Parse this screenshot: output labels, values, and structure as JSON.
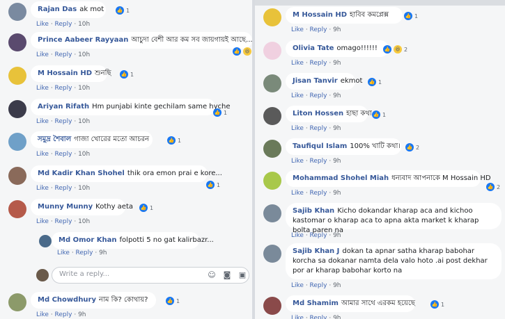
{
  "reply_placeholder": "Write a reply...",
  "comments_left": [
    {
      "name": "Rajan Das",
      "text": "ak mot",
      "actions": "Like · Reply · 10h",
      "reactions": "1",
      "avatar_color": "#7a8aa0"
    },
    {
      "name": "Prince Aabeer Rayyaan",
      "text": "আচুদা বেশী আর কম সব জায়গায়ই আছে...",
      "actions": "Like · Reply · 10h",
      "reactions": "3",
      "avatar_color": "#5a4a6e"
    },
    {
      "name": "M Hossain HD",
      "text": "শুনছি",
      "actions": "Like · Reply · 10h",
      "reactions": "1",
      "avatar_color": "#e8c23a"
    },
    {
      "name": "Ariyan Rifath",
      "text": "Hm punjabi kinte gechilam same hyche",
      "actions": "Like · Reply · 10h",
      "reactions": "1",
      "avatar_color": "#3b3b4a"
    },
    {
      "name": "সমুদ্র শৈবাল",
      "text": "গাজা খোরের মতো আচরন",
      "actions": "Like · Reply · 10h",
      "reactions": "1",
      "avatar_color": "#6fa0c8"
    },
    {
      "name": "Md Kadir Khan Shohel",
      "text": "thik ora emon prai e kore...",
      "actions": "Like · Reply · 10h",
      "reactions": "1",
      "avatar_color": "#8a6a5a"
    },
    {
      "name": "Munny Munny",
      "text": "Kothy aeta",
      "actions": "Like · Reply · 10h",
      "reactions": "1",
      "avatar_color": "#b55a4a"
    },
    {
      "name": "Md Chowdhury",
      "text": "নাম কি? কোথায়?",
      "actions": "Like · Reply · 9h",
      "reactions": "1",
      "avatar_color": "#8c9a6a"
    }
  ],
  "nested_reply": {
    "name": "Md Omor Khan",
    "text": "folpotti 5 no gat kalirbazr...",
    "actions": "Like · Reply · 9h",
    "avatar_color": "#4a6a8a"
  },
  "comments_right": [
    {
      "name": "M Hossain HD",
      "text": "হাবিব কমপ্লেক্স",
      "actions": "Like · Reply · 9h",
      "reactions": "1",
      "avatar_color": "#e8c23a"
    },
    {
      "name": "Olivia Tate",
      "text": "omago!!!!!!",
      "actions": "Like · Reply · 9h",
      "reactions": "2",
      "avatar_color": "#f0d0e0"
    },
    {
      "name": "Jisan Tanvir",
      "text": "ekmot",
      "actions": "Like · Reply · 9h",
      "reactions": "1",
      "avatar_color": "#7a8a7a"
    },
    {
      "name": "Liton Hossen",
      "text": "হাছা কথা",
      "actions": "Like · Reply · 9h",
      "reactions": "1",
      "avatar_color": "#5a5a5a"
    },
    {
      "name": "Taufiqul Islam",
      "text": "100% খাটি কথা।",
      "actions": "Like · Reply · 9h",
      "reactions": "2",
      "avatar_color": "#6a7a5a"
    },
    {
      "name": "Mohammad Shohel Miah",
      "text": "ধন্যবাদ আপনাকে M Hossain HD",
      "actions": "Like · Reply · 9h",
      "reactions": "2",
      "avatar_color": "#a8c84a"
    },
    {
      "name": "Sajib Khan",
      "text": "Kicho dokandar kharap aca and kichoo kastomar o kharap aca to apna akta market k kharap bolta paren na",
      "actions": "Like · Reply · 9h",
      "reactions": "1",
      "avatar_color": "#7a8a9a"
    },
    {
      "name": "Sajib Khan J",
      "text": "dokan ta apnar satha kharap babohar korcha sa dokanar namta dela valo hoto .ai post dekhar por ar kharap babohar korto na",
      "actions": "Like · Reply · 9h",
      "reactions": "2",
      "avatar_color": "#7a8a9a"
    },
    {
      "name": "Md Shamim",
      "text": "আমার সাথে এরকম হয়েছে",
      "actions": "Like · Reply · 9h",
      "reactions": "1",
      "avatar_color": "#8a4a4a"
    }
  ]
}
